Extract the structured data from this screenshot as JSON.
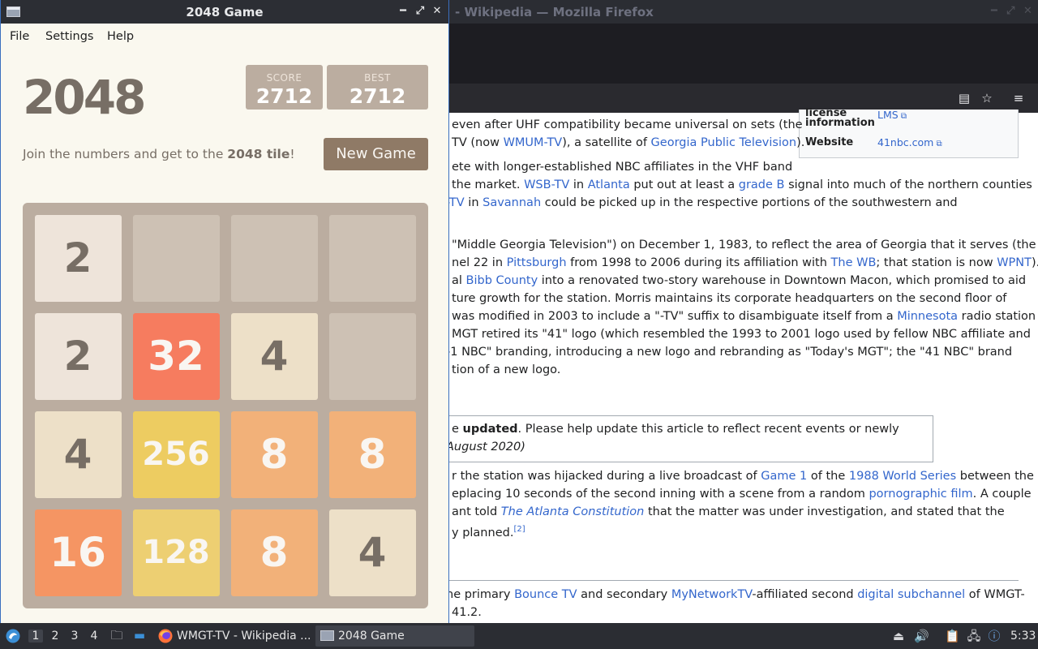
{
  "firefox": {
    "window_title": "- Wikipedia — Mozilla Firefox",
    "infobox": {
      "license_label_1": "license",
      "license_label_2": "information",
      "license_value": "LMS",
      "website_label": "Website",
      "website_value": "41nbc.com"
    },
    "article_lines": [
      [
        "even after UHF compatibility became universal on sets (the"
      ],
      [
        "TV (now ",
        {
          "link": "WMUM-TV"
        },
        "), a satellite of ",
        {
          "link": "Georgia Public Television"
        },
        ")."
      ],
      [
        "ete with longer-established NBC affiliates in the VHF band"
      ],
      [
        "the market. ",
        {
          "link": "WSB-TV"
        },
        " in ",
        {
          "link": "Atlanta"
        },
        " put out at least a ",
        {
          "link": "grade B"
        },
        " signal into much of the northern counties"
      ],
      [
        {
          "link": "-TV"
        },
        " in ",
        {
          "link": "Savannah"
        },
        " could be picked up in the respective portions of the southwestern and"
      ],
      [
        "\"Middle Georgia Television\") on December 1, 1983, to reflect the area of Georgia that it serves (the"
      ],
      [
        "nel 22 in ",
        {
          "link": "Pittsburgh"
        },
        " from 1998 to 2006 during its affiliation with ",
        {
          "link": "The WB"
        },
        "; that station is now ",
        {
          "link": "WPNT"
        },
        ")."
      ],
      [
        "al ",
        {
          "link": "Bibb County"
        },
        " into a renovated two-story warehouse in Downtown Macon, which promised to aid"
      ],
      [
        "ture growth for the station. Morris maintains its corporate headquarters on the second floor of"
      ],
      [
        "was modified in 2003 to include a \"-TV\" suffix to disambiguate itself from a ",
        {
          "link": "Minnesota"
        },
        " radio station"
      ],
      [
        "MGT retired its \"41\" logo (which resembled the 1993 to 2001 logo used by fellow NBC affiliate and"
      ],
      [
        "-1 NBC\" branding, introducing a new logo and rebranding as \"Today's MGT\"; the \"41 NBC\" brand"
      ],
      [
        "tion of a new logo."
      ],
      [
        "e ",
        {
          "bold": "updated"
        },
        ". Please help update this article to reflect recent events or newly"
      ],
      [
        {
          "italic": "August 2020)"
        }
      ],
      [
        "r the station was hijacked during a live broadcast of ",
        {
          "link": "Game 1"
        },
        " of the ",
        {
          "link": "1988 World Series"
        },
        " between the"
      ],
      [
        "eplacing 10 seconds of the second inning with a scene from a random ",
        {
          "link": "pornographic film"
        },
        ". A couple"
      ],
      [
        "ant told ",
        {
          "ilink": "The Atlanta Constitution"
        },
        " that the matter was under investigation, and stated that the"
      ],
      [
        "y planned.",
        {
          "sup": "[2]"
        }
      ],
      [
        "he primary ",
        {
          "link": "Bounce TV"
        },
        " and secondary ",
        {
          "link": "MyNetworkTV"
        },
        "-affiliated second ",
        {
          "link": "digital subchannel"
        },
        " of WMGT-"
      ],
      [
        " 41.2."
      ]
    ]
  },
  "game": {
    "window_title": "2048 Game",
    "menu": [
      "File",
      "Settings",
      "Help"
    ],
    "title": "2048",
    "score_label": "SCORE",
    "score": "2712",
    "best_label": "BEST",
    "best": "2712",
    "intro_pre": "Join the numbers and get to the ",
    "intro_bold": "2048 tile",
    "intro_post": "!",
    "new_game": "New Game",
    "grid": [
      [
        2,
        0,
        0,
        0
      ],
      [
        2,
        32,
        4,
        0
      ],
      [
        4,
        256,
        8,
        8
      ],
      [
        16,
        128,
        8,
        4
      ]
    ],
    "colors": {
      "background": "#faf8ef",
      "board": "#bbada0",
      "empty": "#cdc1b4",
      "tile_2": "#eee4da",
      "tile_4": "#ede0c8",
      "tile_8": "#f2b179",
      "tile_16": "#f59563",
      "tile_32": "#f67c5f",
      "tile_128": "#edcf72",
      "tile_256": "#edcc61",
      "text_dark": "#776e65",
      "text_light": "#f9f6f2",
      "button": "#8f7a66"
    }
  },
  "taskbar": {
    "workspaces": [
      "1",
      "2",
      "3",
      "4"
    ],
    "active_workspace": "1",
    "tasks": [
      {
        "label": "WMGT-TV - Wikipedia ...",
        "icon": "firefox-icon"
      },
      {
        "label": "2048 Game",
        "icon": "window-icon"
      }
    ],
    "clock": "5:33",
    "tray_icons": [
      "storage-icon",
      "volume-icon",
      "clipboard-icon",
      "network-icon",
      "notification-icon"
    ]
  }
}
